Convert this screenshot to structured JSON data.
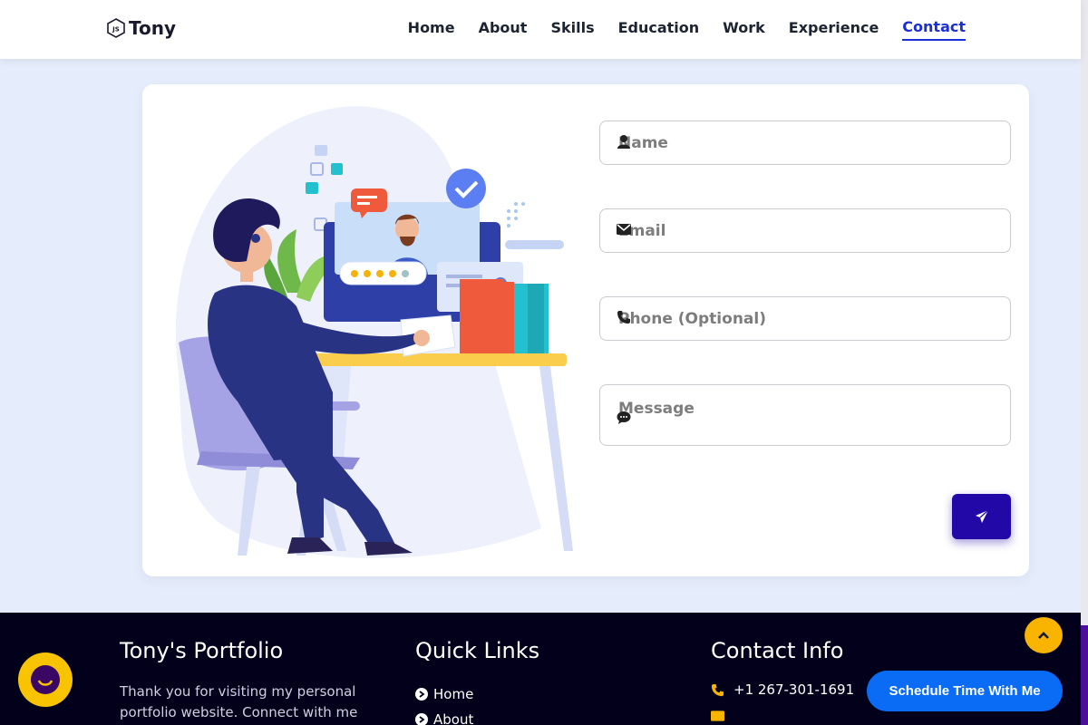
{
  "header": {
    "logo_text": "Tony",
    "nav": [
      {
        "label": "Home"
      },
      {
        "label": "About"
      },
      {
        "label": "Skills"
      },
      {
        "label": "Education"
      },
      {
        "label": "Work"
      },
      {
        "label": "Experience"
      },
      {
        "label": "Contact",
        "active": true
      }
    ]
  },
  "form": {
    "name_placeholder": "Name",
    "email_placeholder": "Email",
    "phone_placeholder": "Phone (Optional)",
    "message_placeholder": "Message"
  },
  "footer": {
    "about": {
      "title": "Tony's Portfolio",
      "text": "Thank you for visiting my personal portfolio website. Connect with me"
    },
    "quick_links": {
      "title": "Quick Links",
      "items": [
        "Home",
        "About"
      ]
    },
    "contact": {
      "title": "Contact Info",
      "phone": "+1 267-301-1691"
    }
  },
  "floating": {
    "schedule_label": "Schedule Time With Me"
  },
  "colors": {
    "accent": "#1a2fd6",
    "send_button": "#2308a8",
    "footer_bg": "#03001c",
    "yellow": "#f8c400",
    "schedule_bg": "#0a6cf5"
  }
}
